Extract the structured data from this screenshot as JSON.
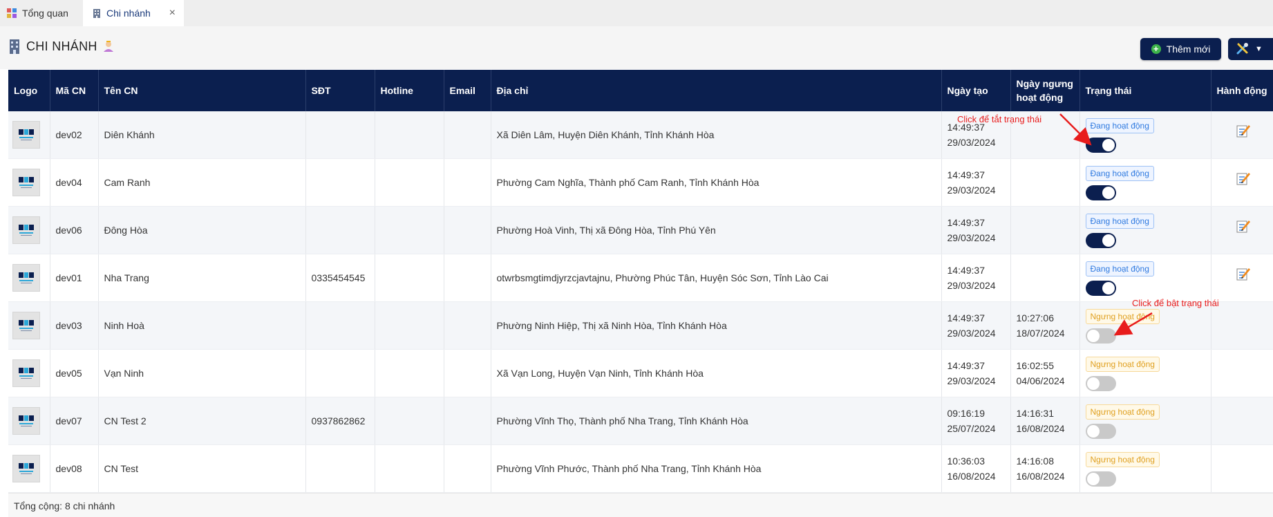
{
  "tabs": [
    {
      "label": "Tổng quan",
      "icon": "dashboard-icon"
    },
    {
      "label": "Chi nhánh",
      "icon": "building-icon",
      "active": true
    }
  ],
  "page": {
    "title": "CHI NHÁNH",
    "add_button": "Thêm mới",
    "tools_icon": "tools-icon"
  },
  "table": {
    "headers": [
      "Logo",
      "Mã CN",
      "Tên CN",
      "SĐT",
      "Hotline",
      "Email",
      "Địa chỉ",
      "Ngày tạo",
      "Ngày ngưng hoạt động",
      "Trạng thái",
      "Hành động"
    ],
    "rows": [
      {
        "code": "dev02",
        "name": "Diên Khánh",
        "phone": "",
        "hotline": "",
        "email": "",
        "address": "Xã Diên Lâm, Huyện Diên Khánh, Tỉnh Khánh Hòa",
        "created_time": "14:49:37",
        "created_date": "29/03/2024",
        "stopped_time": "",
        "stopped_date": "",
        "status": "Đang hoạt động",
        "active": true
      },
      {
        "code": "dev04",
        "name": "Cam Ranh",
        "phone": "",
        "hotline": "",
        "email": "",
        "address": "Phường Cam Nghĩa, Thành phố Cam Ranh, Tỉnh Khánh Hòa",
        "created_time": "14:49:37",
        "created_date": "29/03/2024",
        "stopped_time": "",
        "stopped_date": "",
        "status": "Đang hoạt động",
        "active": true
      },
      {
        "code": "dev06",
        "name": "Đông Hòa",
        "phone": "",
        "hotline": "",
        "email": "",
        "address": "Phường Hoà Vinh, Thị xã Đông Hòa, Tỉnh Phú Yên",
        "created_time": "14:49:37",
        "created_date": "29/03/2024",
        "stopped_time": "",
        "stopped_date": "",
        "status": "Đang hoạt động",
        "active": true
      },
      {
        "code": "dev01",
        "name": "Nha Trang",
        "phone": "0335454545",
        "hotline": "",
        "email": "",
        "address": "otwrbsmgtimdjyrzcjavtajnu, Phường Phúc Tân, Huyện Sóc Sơn, Tỉnh Lào Cai",
        "created_time": "14:49:37",
        "created_date": "29/03/2024",
        "stopped_time": "",
        "stopped_date": "",
        "status": "Đang hoạt động",
        "active": true
      },
      {
        "code": "dev03",
        "name": "Ninh Hoà",
        "phone": "",
        "hotline": "",
        "email": "",
        "address": "Phường Ninh Hiệp, Thị xã Ninh Hòa, Tỉnh Khánh Hòa",
        "created_time": "14:49:37",
        "created_date": "29/03/2024",
        "stopped_time": "10:27:06",
        "stopped_date": "18/07/2024",
        "status": "Ngưng hoạt động",
        "active": false
      },
      {
        "code": "dev05",
        "name": "Vạn Ninh",
        "phone": "",
        "hotline": "",
        "email": "",
        "address": "Xã Vạn Long, Huyện Vạn Ninh, Tỉnh Khánh Hòa",
        "created_time": "14:49:37",
        "created_date": "29/03/2024",
        "stopped_time": "16:02:55",
        "stopped_date": "04/06/2024",
        "status": "Ngưng hoạt động",
        "active": false
      },
      {
        "code": "dev07",
        "name": "CN Test 2",
        "phone": "0937862862",
        "hotline": "",
        "email": "",
        "address": "Phường Vĩnh Thọ, Thành phố Nha Trang, Tỉnh Khánh Hòa",
        "created_time": "09:16:19",
        "created_date": "25/07/2024",
        "stopped_time": "14:16:31",
        "stopped_date": "16/08/2024",
        "status": "Ngưng hoạt động",
        "active": false
      },
      {
        "code": "dev08",
        "name": "CN Test",
        "phone": "",
        "hotline": "",
        "email": "",
        "address": "Phường Vĩnh Phước, Thành phố Nha Trang, Tỉnh Khánh Hòa",
        "created_time": "10:36:03",
        "created_date": "16/08/2024",
        "stopped_time": "14:16:08",
        "stopped_date": "16/08/2024",
        "status": "Ngưng hoạt động",
        "active": false
      }
    ]
  },
  "footer": {
    "total": "Tổng cộng: 8 chi nhánh"
  },
  "annotations": {
    "turn_off": "Click để tắt trạng thái",
    "turn_on": "Click để bật trạng thái",
    "color": "#e81c1c"
  },
  "colors": {
    "primary": "#0b1f4f",
    "active_badge": "#2f7ae0",
    "inactive_badge": "#e0a020",
    "add_icon": "#3db34a"
  }
}
